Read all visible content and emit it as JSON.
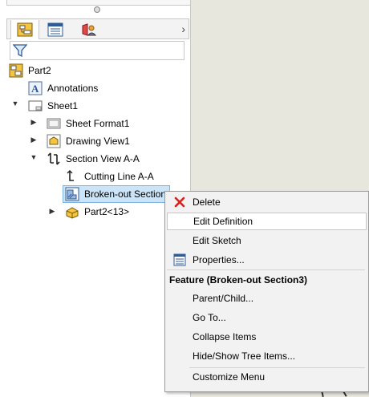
{
  "tabs": [
    {
      "name": "feature-manager-tab",
      "active": true
    },
    {
      "name": "property-manager-tab",
      "active": false
    },
    {
      "name": "display-manager-tab",
      "active": false
    }
  ],
  "tree": {
    "root": "Part2",
    "annotations": "Annotations",
    "sheet": "Sheet1",
    "sheet_format": "Sheet Format1",
    "drawing_view": "Drawing View1",
    "section_view": "Section View A-A",
    "cutting_line": "Cutting Line A-A",
    "broken_out": "Broken-out Section",
    "part_ref": "Part2<13>"
  },
  "context_menu": {
    "delete": "Delete",
    "edit_definition": "Edit Definition",
    "edit_sketch": "Edit Sketch",
    "properties": "Properties...",
    "header": "Feature (Broken-out Section3)",
    "parent_child": "Parent/Child...",
    "go_to": "Go To...",
    "collapse": "Collapse Items",
    "hide_show": "Hide/Show Tree Items...",
    "customize": "Customize Menu"
  },
  "colors": {
    "selection_bg": "#cce4f7",
    "delete_red": "#d9221b",
    "canvas_bg": "#e8e7de"
  }
}
